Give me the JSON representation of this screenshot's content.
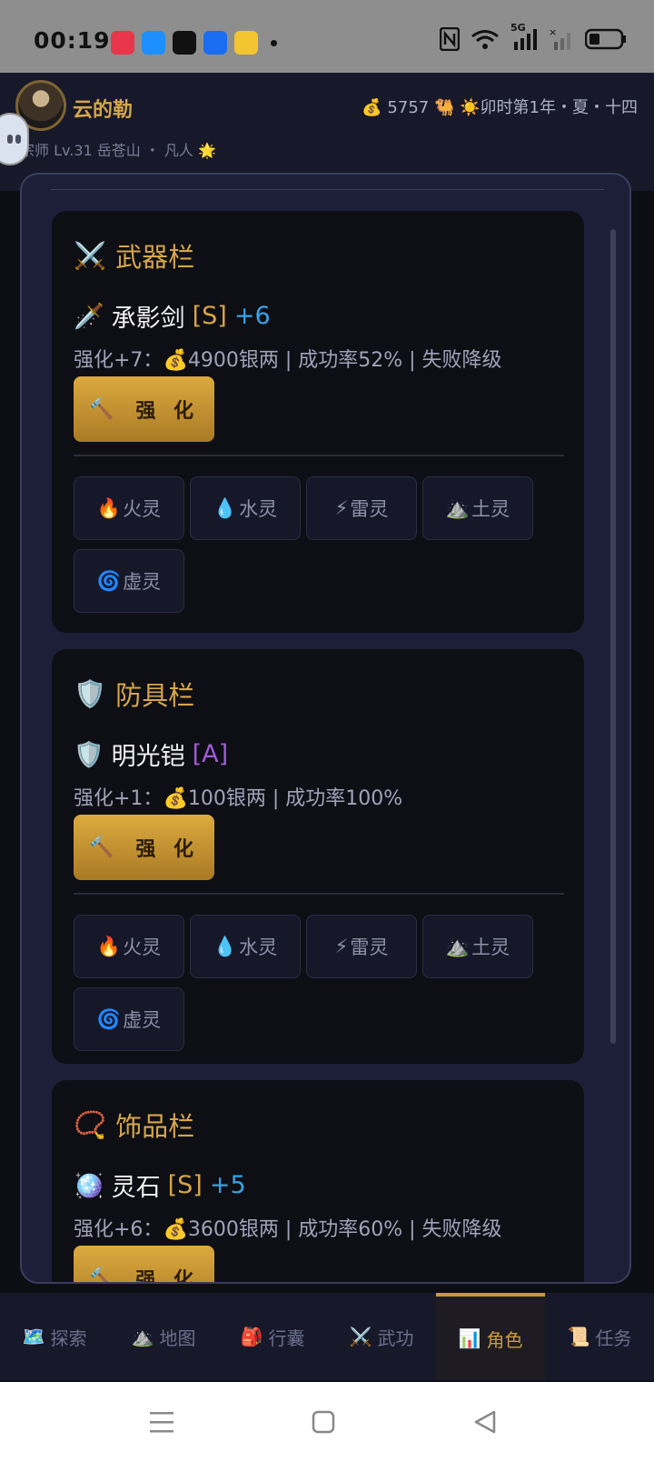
{
  "status_bar": {
    "time": "00:19",
    "network": "5G",
    "apps": [
      "game-app-icon",
      "browser-app-icon",
      "tiktok-app-icon",
      "shield-app-icon",
      "yellow-app-icon"
    ]
  },
  "header": {
    "player_name": "云的勒",
    "silver": "5757",
    "time_text": "卯时第1年・夏・十四",
    "subline": "宗师 Lv.31 岳苍山 ・ 凡人",
    "colors": {
      "gold": "#d6a648",
      "panel": "#17182a"
    }
  },
  "cards": [
    {
      "title": "武器栏",
      "title_icon": "crossed-swords-icon",
      "item_icon": "dagger-icon",
      "item_name": "承影剑",
      "grade": "[S]",
      "plus": "+6",
      "cost_text": "强化+7：",
      "cost_detail": "4900银两 | 成功率52% | 失败降级",
      "enhance_label": "强 化"
    },
    {
      "title": "防具栏",
      "title_icon": "shield-icon",
      "item_icon": "shield-icon",
      "item_name": "明光铠",
      "grade": "[A]",
      "plus": "",
      "cost_text": "强化+1：",
      "cost_detail": "100银两 | 成功率100%",
      "enhance_label": "强 化"
    },
    {
      "title": "饰品栏",
      "title_icon": "necklace-icon",
      "item_icon": "spirit-stone-icon",
      "item_name": "灵石",
      "grade": "[S]",
      "plus": "+5",
      "cost_text": "强化+6：",
      "cost_detail": "3600银两 | 成功率60% | 失败降级",
      "enhance_label": "强 化"
    }
  ],
  "gems": [
    "火灵",
    "水灵",
    "雷灵",
    "土灵",
    "虚灵"
  ],
  "bottom_nav": [
    "探索",
    "地图",
    "行囊",
    "武功",
    "角色",
    "任务"
  ],
  "active_tab": "角色"
}
